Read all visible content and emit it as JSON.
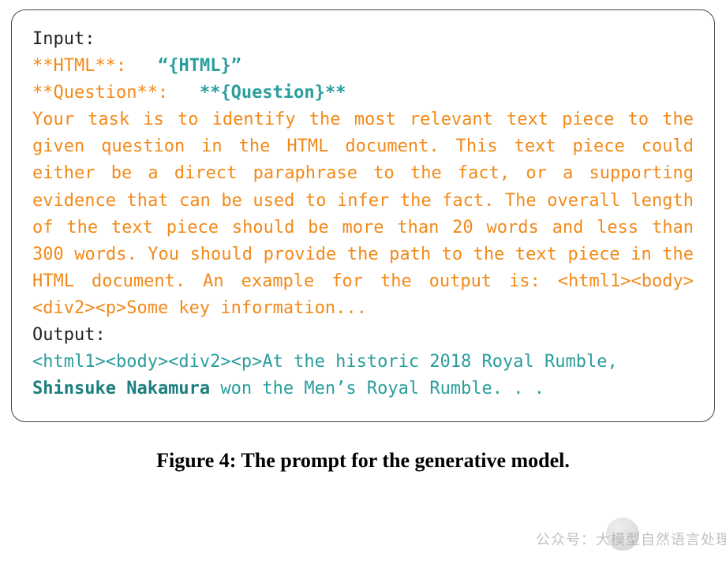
{
  "prompt": {
    "input_label": "Input:",
    "html_key": "**HTML**:",
    "html_value": "“{HTML}”",
    "question_key": "**Question**:",
    "question_value": "**{Question}**",
    "instructions": "Your task is to identify the most relevant text piece to the given question in the HTML document. This text piece could either be a direct paraphrase to the fact, or a supporting evidence that can be used to infer the fact. The overall length of the text piece should be more than 20 words and less than 300 words. You should provide the path to the text piece in the HTML document. An example for the output is: <html1><body><div2><p>Some key information...",
    "output_label": "Output:",
    "output_prefix": "<html1><body><div2><p>At the historic 2018 Royal Rumble, ",
    "output_highlight": "Shinsuke Nakamura",
    "output_suffix": " won the Men’s Royal Rumble. . ."
  },
  "caption": "Figure 4: The prompt for the generative model.",
  "watermark_text": "公众号：大模型自然语言处理"
}
